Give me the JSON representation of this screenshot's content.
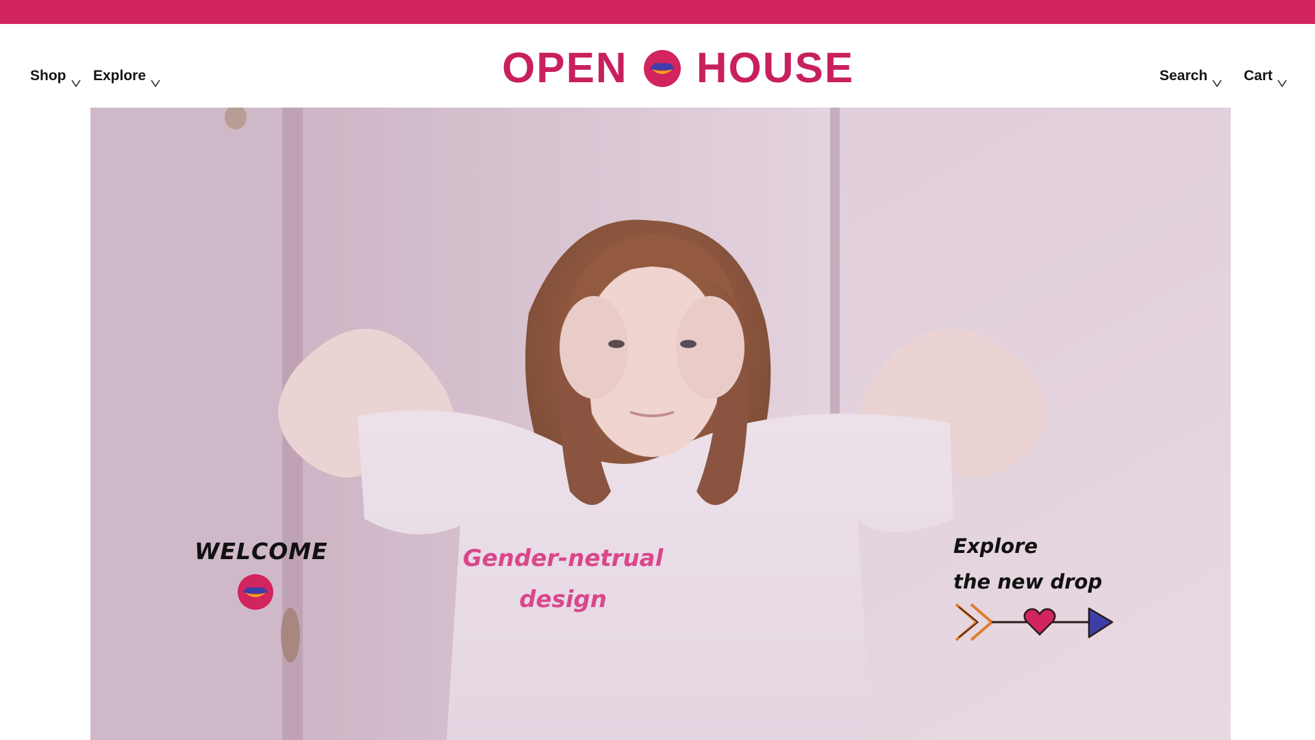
{
  "brand": {
    "left_word": "OPEN",
    "right_word": "HOUSE",
    "color": "#c8205e",
    "mark_icon": "lips-emblem-icon"
  },
  "top_bar": {
    "color": "#d2245f"
  },
  "nav": {
    "left": [
      {
        "label": "Shop",
        "icon": "chevron-down-icon"
      },
      {
        "label": "Explore",
        "icon": "chevron-down-icon"
      }
    ],
    "right": [
      {
        "label": "Search",
        "icon": "chevron-down-icon"
      },
      {
        "label": "Cart",
        "icon": "chevron-down-icon"
      }
    ]
  },
  "hero": {
    "welcome_text": "WELCOME",
    "welcome_icon": "lips-emblem-icon",
    "slogan_line1": "Gender-netrual",
    "slogan_line2": "design",
    "explore_line1": "Explore",
    "explore_line2": "the new drop",
    "arrow_icon": "heart-arrow-icon",
    "slogan_color": "#d9478a",
    "background": "photo of a person in a white t-shirt against a lilac wall"
  }
}
